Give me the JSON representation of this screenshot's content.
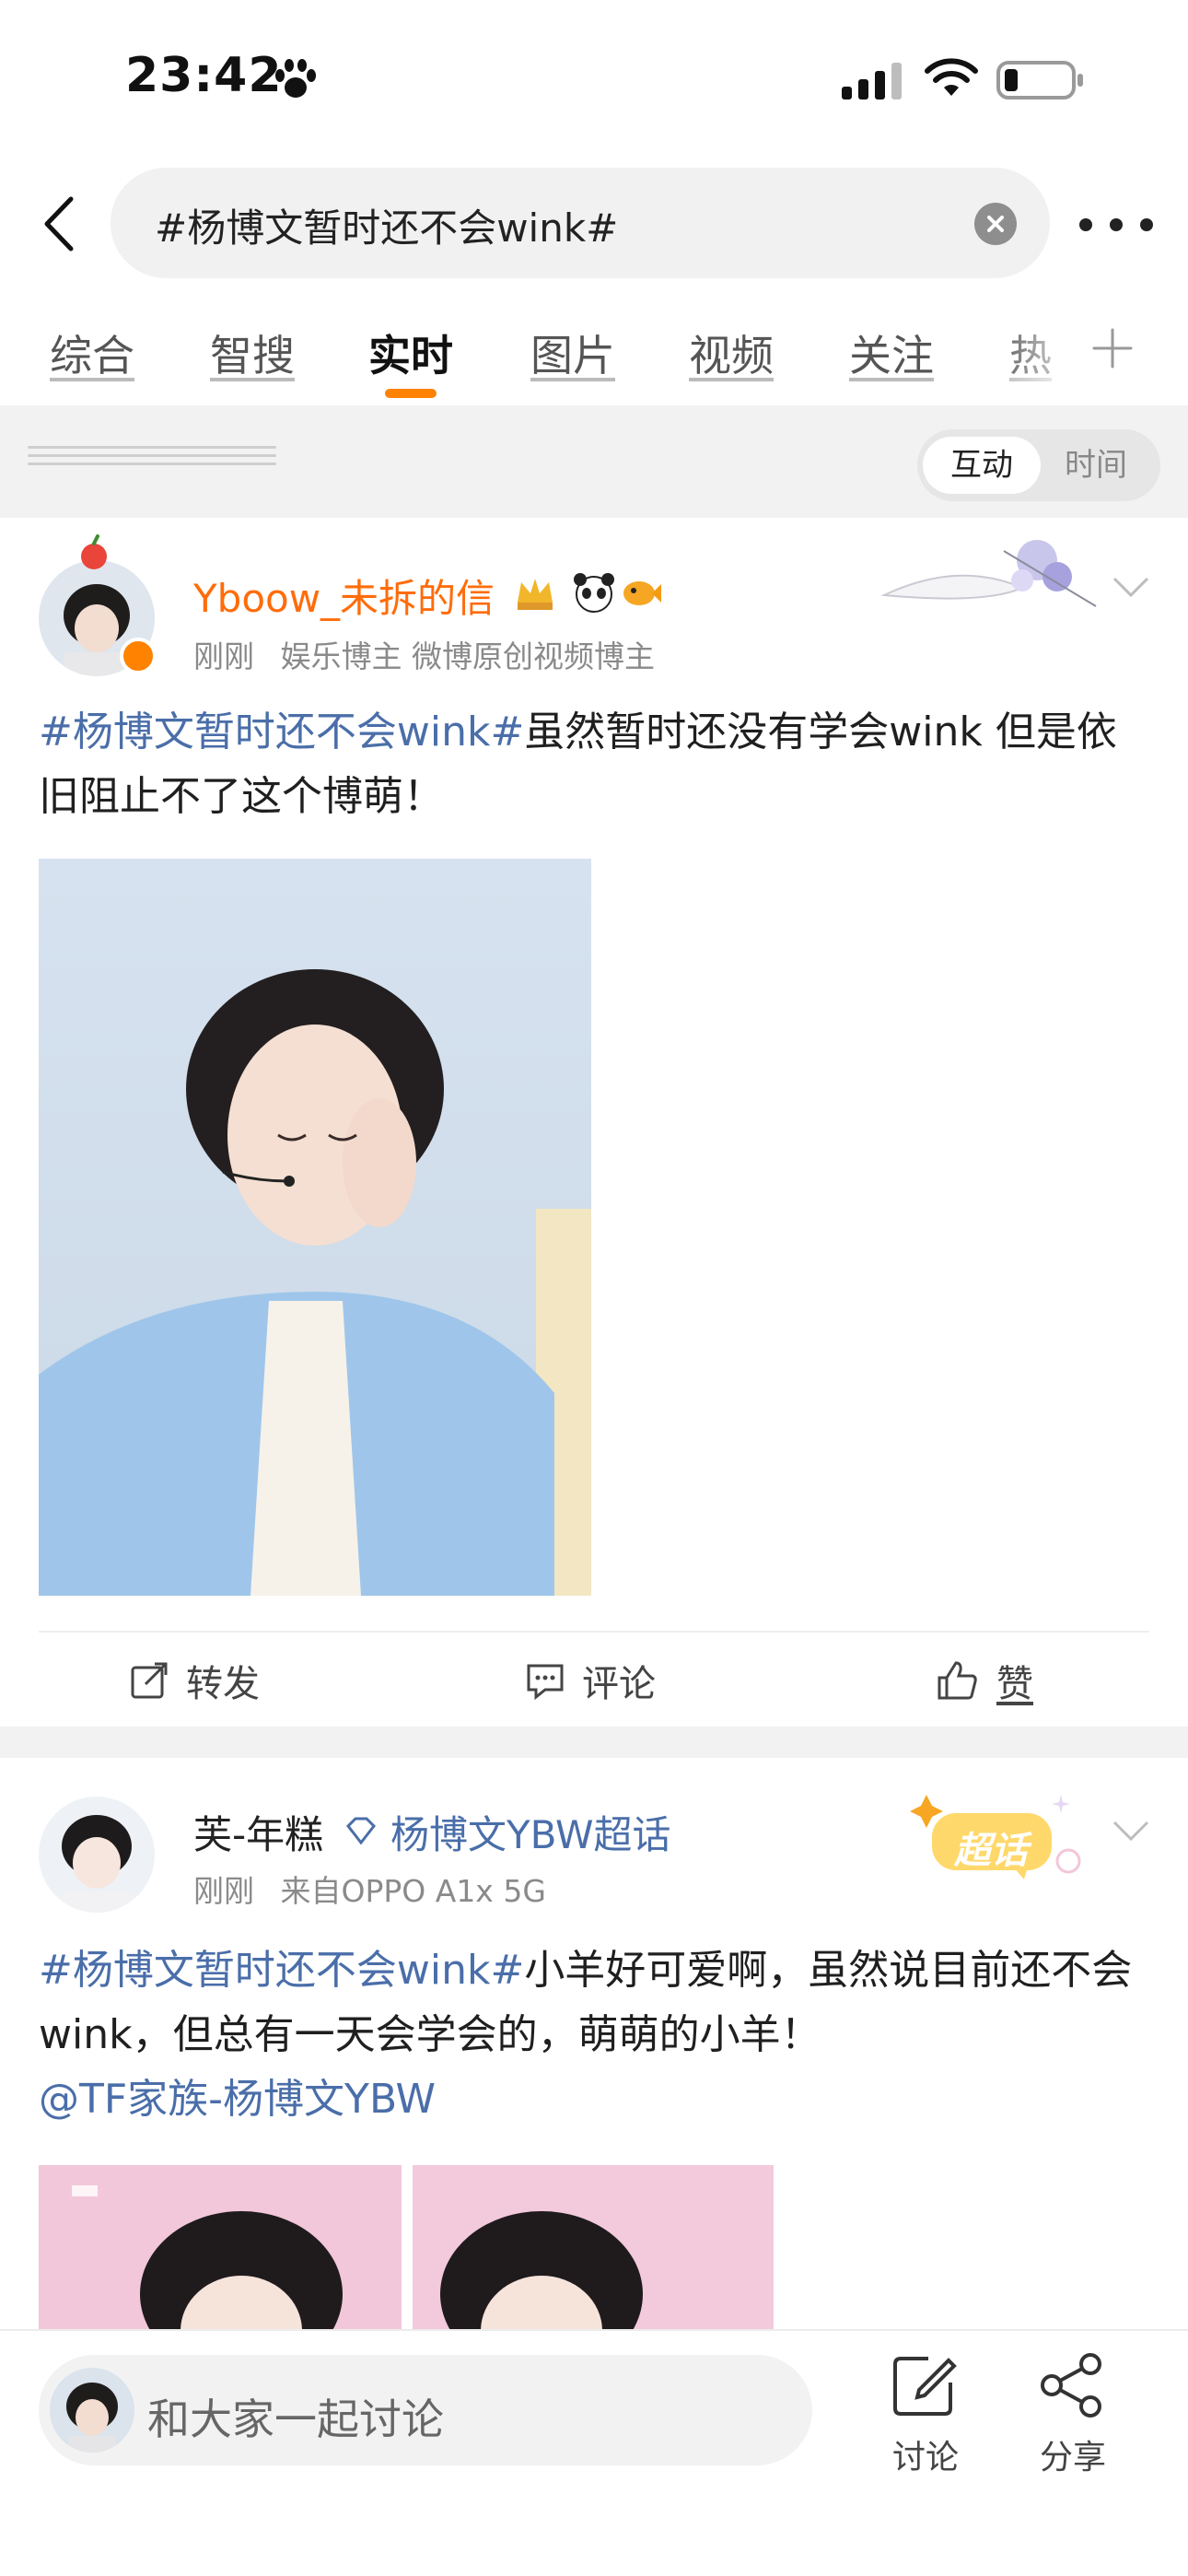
{
  "status_bar": {
    "time": "23:42"
  },
  "search": {
    "query": "#杨博文暂时还不会wink#"
  },
  "tabs": [
    {
      "label": "综合"
    },
    {
      "label": "智搜"
    },
    {
      "label": "实时",
      "active": true
    },
    {
      "label": "图片"
    },
    {
      "label": "视频"
    },
    {
      "label": "关注"
    },
    {
      "label": "热"
    }
  ],
  "sort": {
    "options": [
      "互动",
      "时间"
    ],
    "selected": "互动"
  },
  "posts": [
    {
      "author": "Yboow_未拆的信",
      "meta": [
        "刚刚",
        "娱乐博主 微博原创视频博主"
      ],
      "hashtag": "#杨博文暂时还不会wink#",
      "text": "虽然暂时还没有学会wink 但是依旧阻止不了这个博萌！",
      "actions": {
        "repost": "转发",
        "comment": "评论",
        "like": "赞"
      }
    },
    {
      "author": "芙-年糕",
      "supertopic": "杨博文YBW超话",
      "meta": [
        "刚刚",
        "来自OPPO A1x 5G"
      ],
      "hashtag": "#杨博文暂时还不会wink#",
      "text": "小羊好可爱啊，虽然说目前还不会wink，但总有一天会学会的，萌萌的小羊！",
      "mention": "@TF家族-杨博文YBW",
      "badge": "超话"
    }
  ],
  "bottom_bar": {
    "placeholder": "和大家一起讨论",
    "discuss": "讨论",
    "share": "分享"
  },
  "colors": {
    "accent": "#ff8200",
    "link": "#4a6ea9",
    "username": "#ff6c0a"
  }
}
